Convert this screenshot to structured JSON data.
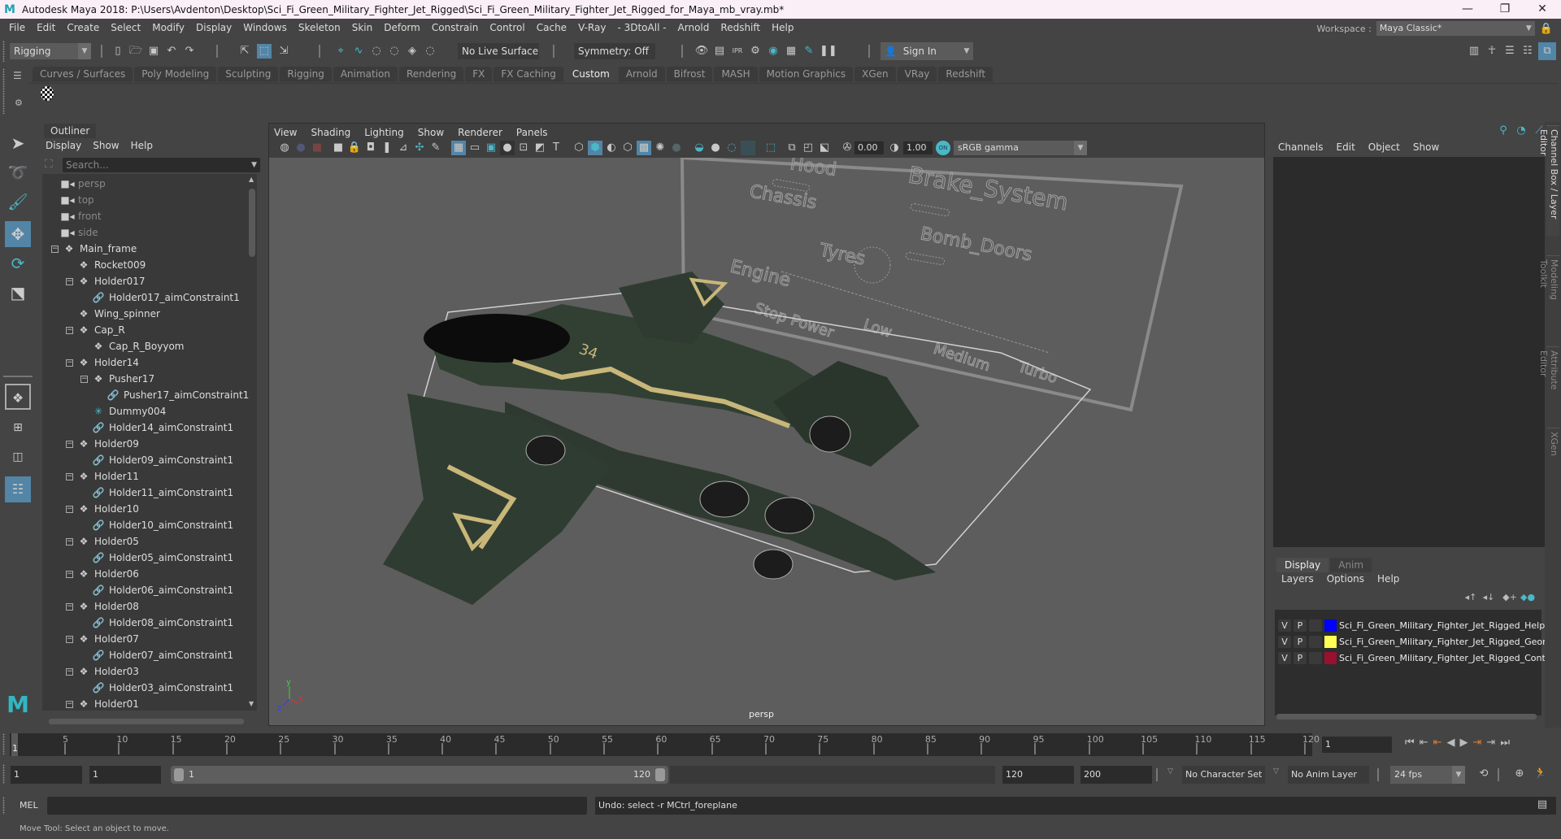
{
  "window": {
    "title": "Autodesk Maya 2018: P:\\Users\\Avdenton\\Desktop\\Sci_Fi_Green_Military_Fighter_Jet_Rigged\\Sci_Fi_Green_Military_Fighter_Jet_Rigged_for_Maya_mb_vray.mb*",
    "minimize": "—",
    "maximize": "❐",
    "close": "✕"
  },
  "menubar": {
    "items": [
      "File",
      "Edit",
      "Create",
      "Select",
      "Modify",
      "Display",
      "Windows",
      "Skeleton",
      "Skin",
      "Deform",
      "Constrain",
      "Control",
      "Cache",
      "V-Ray",
      "- 3DtoAll -",
      "Arnold",
      "Redshift",
      "Help"
    ],
    "workspace_label": "Workspace :",
    "workspace_value": "Maya Classic*"
  },
  "statusline": {
    "menuset": "Rigging",
    "live_surface": "No Live Surface",
    "symmetry": "Symmetry: Off",
    "sign_in": "Sign In"
  },
  "shelf": {
    "tabs": [
      "Curves / Surfaces",
      "Poly Modeling",
      "Sculpting",
      "Rigging",
      "Animation",
      "Rendering",
      "FX",
      "FX Caching",
      "Custom",
      "Arnold",
      "Bifrost",
      "MASH",
      "Motion Graphics",
      "XGen",
      "VRay",
      "Redshift"
    ],
    "active_tab": "Custom"
  },
  "outliner": {
    "tab": "Outliner",
    "menu": [
      "Display",
      "Show",
      "Help"
    ],
    "search_placeholder": "Search...",
    "items": [
      {
        "label": "persp",
        "type": "camera",
        "depth": 0
      },
      {
        "label": "top",
        "type": "camera",
        "depth": 0
      },
      {
        "label": "front",
        "type": "camera",
        "depth": 0
      },
      {
        "label": "side",
        "type": "camera",
        "depth": 0
      },
      {
        "label": "Main_frame",
        "type": "transform",
        "depth": 0,
        "expanded": true
      },
      {
        "label": "Rocket009",
        "type": "transform",
        "depth": 1
      },
      {
        "label": "Holder017",
        "type": "transform",
        "depth": 1,
        "expanded": true
      },
      {
        "label": "Holder017_aimConstraint1",
        "type": "constraint",
        "depth": 2
      },
      {
        "label": "Wing_spinner",
        "type": "transform",
        "depth": 1
      },
      {
        "label": "Cap_R",
        "type": "transform",
        "depth": 1,
        "expanded": true
      },
      {
        "label": "Cap_R_Boyyom",
        "type": "transform",
        "depth": 2
      },
      {
        "label": "Holder14",
        "type": "transform",
        "depth": 1,
        "expanded": true
      },
      {
        "label": "Pusher17",
        "type": "transform",
        "depth": 2,
        "expanded": true
      },
      {
        "label": "Pusher17_aimConstraint1",
        "type": "constraint",
        "depth": 3
      },
      {
        "label": "Dummy004",
        "type": "locator",
        "depth": 2
      },
      {
        "label": "Holder14_aimConstraint1",
        "type": "constraint",
        "depth": 2
      },
      {
        "label": "Holder09",
        "type": "transform",
        "depth": 1,
        "expanded": true
      },
      {
        "label": "Holder09_aimConstraint1",
        "type": "constraint",
        "depth": 2
      },
      {
        "label": "Holder11",
        "type": "transform",
        "depth": 1,
        "expanded": true
      },
      {
        "label": "Holder11_aimConstraint1",
        "type": "constraint",
        "depth": 2
      },
      {
        "label": "Holder10",
        "type": "transform",
        "depth": 1,
        "expanded": true
      },
      {
        "label": "Holder10_aimConstraint1",
        "type": "constraint",
        "depth": 2
      },
      {
        "label": "Holder05",
        "type": "transform",
        "depth": 1,
        "expanded": true
      },
      {
        "label": "Holder05_aimConstraint1",
        "type": "constraint",
        "depth": 2
      },
      {
        "label": "Holder06",
        "type": "transform",
        "depth": 1,
        "expanded": true
      },
      {
        "label": "Holder06_aimConstraint1",
        "type": "constraint",
        "depth": 2
      },
      {
        "label": "Holder08",
        "type": "transform",
        "depth": 1,
        "expanded": true
      },
      {
        "label": "Holder08_aimConstraint1",
        "type": "constraint",
        "depth": 2
      },
      {
        "label": "Holder07",
        "type": "transform",
        "depth": 1,
        "expanded": true
      },
      {
        "label": "Holder07_aimConstraint1",
        "type": "constraint",
        "depth": 2
      },
      {
        "label": "Holder03",
        "type": "transform",
        "depth": 1,
        "expanded": true
      },
      {
        "label": "Holder03_aimConstraint1",
        "type": "constraint",
        "depth": 2
      },
      {
        "label": "Holder01",
        "type": "transform",
        "depth": 1,
        "expanded": true
      }
    ]
  },
  "viewport": {
    "menu": [
      "View",
      "Shading",
      "Lighting",
      "Show",
      "Renderer",
      "Panels"
    ],
    "exposure": "0.00",
    "gamma": "1.00",
    "color_mgmt_badge": "ON",
    "color_space": "sRGB gamma",
    "camera_label": "persp",
    "axis": {
      "x": "x",
      "y": "y",
      "z": "z"
    },
    "control_panel": {
      "labels": [
        "Hood",
        "Chassis",
        "Brake_System",
        "Bomb_Doors",
        "Tyres",
        "Engine",
        "Stop Power",
        "Low",
        "Medium",
        "Turbo"
      ]
    },
    "model_marking": "34"
  },
  "channelbox": {
    "menu": [
      "Channels",
      "Edit",
      "Object",
      "Show"
    ]
  },
  "layereditor": {
    "tabs": [
      "Display",
      "Anim"
    ],
    "active_tab": "Display",
    "menu": [
      "Layers",
      "Options",
      "Help"
    ],
    "layers": [
      {
        "v": "V",
        "p": "P",
        "color": "#0000ff",
        "name": "Sci_Fi_Green_Military_Fighter_Jet_Rigged_Help"
      },
      {
        "v": "V",
        "p": "P",
        "color": "#ffff55",
        "name": "Sci_Fi_Green_Military_Fighter_Jet_Rigged_Geom"
      },
      {
        "v": "V",
        "p": "P",
        "color": "#99112e",
        "name": "Sci_Fi_Green_Military_Fighter_Jet_Rigged_Contro"
      }
    ]
  },
  "sidetabs": [
    "Channel Box / Layer Editor",
    "Modeling Toolkit",
    "Attribute Editor",
    "XGen"
  ],
  "timeline": {
    "start": 1,
    "end": 120,
    "current_frame": "1",
    "tick_labels": [
      5,
      10,
      15,
      20,
      25,
      30,
      35,
      40,
      45,
      50,
      55,
      60,
      65,
      70,
      75,
      80,
      85,
      90,
      95,
      100,
      105,
      110,
      115,
      120
    ],
    "current_frame_field": "1"
  },
  "range": {
    "start_field": "1",
    "playback_start": "1",
    "range_start_label": "1",
    "range_end_label": "120",
    "playback_end": "120",
    "end_field": "200",
    "character_set": "No Character Set",
    "anim_layer": "No Anim Layer",
    "fps": "24 fps"
  },
  "commandline": {
    "lang": "MEL",
    "input": "",
    "result": "Undo: select -r MCtrl_foreplane"
  },
  "helpline": "Move Tool: Select an object to move."
}
